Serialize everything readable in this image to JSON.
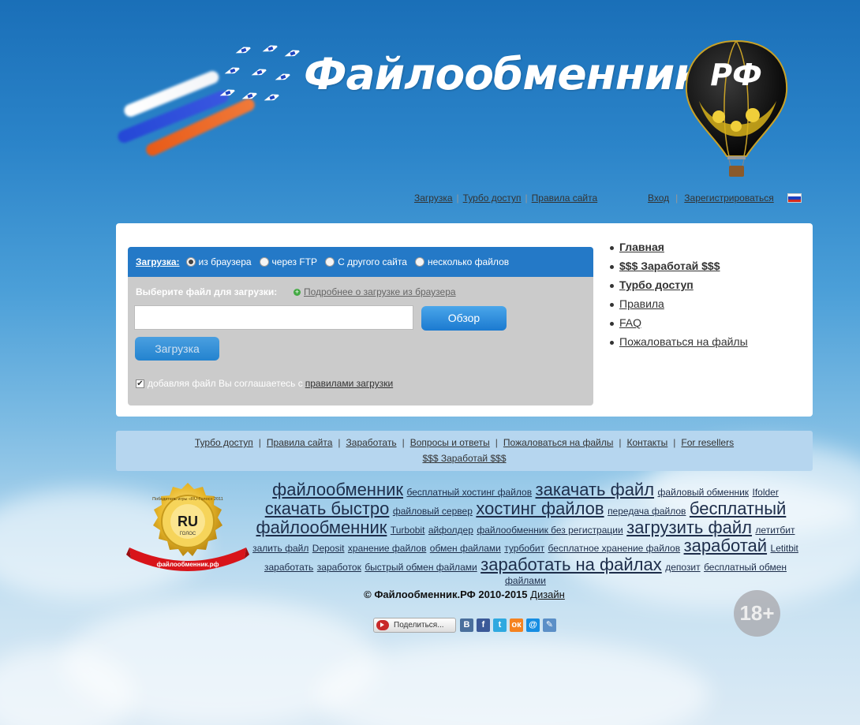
{
  "site": {
    "title": "Файлообменник"
  },
  "balloon_text": "РФ",
  "topnav": {
    "left": [
      "Загрузка",
      "Турбо доступ",
      "Правила сайта"
    ],
    "login": "Вход",
    "register": "Зарегистрироваться"
  },
  "upload": {
    "label": "Загрузка:",
    "methods": [
      "из браузера",
      "через FTP",
      "С другого сайта",
      "несколько файлов"
    ],
    "selected_method": "из браузера",
    "choose_label": "Выберите файл для загрузки:",
    "more_link": "Подробнее о загрузке из браузера",
    "file_value": "",
    "browse_label": "Обзор",
    "upload_label": "Загрузка",
    "agree_text": "добавляя файл Вы соглашаетесь с",
    "agree_link": "правилами загрузки",
    "agree_checked": true
  },
  "side_menu": [
    {
      "label": "Главная",
      "bold": true
    },
    {
      "label": "$$$ Заработай $$$",
      "bold": true
    },
    {
      "label": "Турбо доступ",
      "bold": true
    },
    {
      "label": "Правила",
      "bold": false
    },
    {
      "label": "FAQ",
      "bold": false
    },
    {
      "label": "Пожаловаться на файлы",
      "bold": false
    }
  ],
  "footnav": {
    "links": [
      "Турбо доступ",
      "Правила сайта",
      "Заработать",
      "Вопросы и ответы",
      "Пожаловаться на файлы",
      "Контакты",
      "For resellers"
    ],
    "second": "$$$ Заработай $$$"
  },
  "badge": {
    "title": "RU",
    "subtitle": "ГОЛОС",
    "ring": "Победитель игры «RU-Голос» 2011",
    "ribbon": "файлообменник.рф"
  },
  "tags": [
    {
      "t": "файлообменник",
      "s": 22
    },
    {
      "t": "бесплатный хостинг файлов",
      "s": 12
    },
    {
      "t": "закачать файл",
      "s": 22
    },
    {
      "t": "файловый обменник",
      "s": 12
    },
    {
      "t": "Ifolder",
      "s": 12
    },
    {
      "t": "скачать быстро",
      "s": 22
    },
    {
      "t": "файловый сервер",
      "s": 12
    },
    {
      "t": "хостинг файлов",
      "s": 22
    },
    {
      "t": "передача файлов",
      "s": 12
    },
    {
      "t": "бесплатный файлообменник",
      "s": 22
    },
    {
      "t": "Turbobit",
      "s": 12
    },
    {
      "t": "айфолдер",
      "s": 12
    },
    {
      "t": "файлообменник без регистрации",
      "s": 12
    },
    {
      "t": "загрузить файл",
      "s": 22
    },
    {
      "t": "летитбит",
      "s": 12
    },
    {
      "t": "залить файл",
      "s": 12
    },
    {
      "t": "Deposit",
      "s": 12
    },
    {
      "t": "хранение файлов",
      "s": 12
    },
    {
      "t": "обмен файлами",
      "s": 12
    },
    {
      "t": "турбобит",
      "s": 12
    },
    {
      "t": "бесплатное хранение файлов",
      "s": 12
    },
    {
      "t": "заработай",
      "s": 22
    },
    {
      "t": "Letitbit",
      "s": 12
    },
    {
      "t": "заработать",
      "s": 12
    },
    {
      "t": "заработок",
      "s": 12
    },
    {
      "t": "быстрый обмен файлами",
      "s": 12
    },
    {
      "t": "заработать на файлах",
      "s": 22
    },
    {
      "t": "депозит",
      "s": 12
    },
    {
      "t": "бесплатный обмен файлами",
      "s": 12
    }
  ],
  "footer": {
    "copyright": "© Файлообменник.РФ 2010-2015",
    "design": "Дизайн"
  },
  "share": {
    "label": "Поделиться...",
    "icons": [
      {
        "name": "vk-icon",
        "glyph": "В",
        "color": "#4a6f9c"
      },
      {
        "name": "facebook-icon",
        "glyph": "f",
        "color": "#3b5998"
      },
      {
        "name": "twitter-icon",
        "glyph": "t",
        "color": "#2fa9e0"
      },
      {
        "name": "odnoklassniki-icon",
        "glyph": "ок",
        "color": "#f58220"
      },
      {
        "name": "mailru-icon",
        "glyph": "@",
        "color": "#168de2"
      },
      {
        "name": "livejournal-icon",
        "glyph": "✎",
        "color": "#5b8fc7"
      }
    ]
  },
  "age_badge": "18+"
}
